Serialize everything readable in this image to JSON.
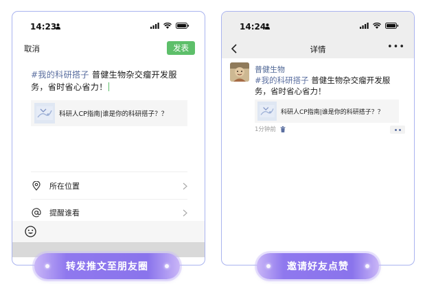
{
  "left_phone": {
    "status": {
      "time": "14:23"
    },
    "header": {
      "cancel_label": "取消",
      "publish_label": "发表"
    },
    "compose": {
      "hashtag": "#我的科研搭子",
      "text": " 普健生物杂交瘤开发服务，省时省心省力！"
    },
    "link_card": {
      "title": "科研人CP指南|谁是你的科研搭子？？"
    },
    "menu": [
      {
        "icon": "location-pin-icon",
        "label": "所在位置"
      },
      {
        "icon": "at-sign-icon",
        "label": "提醒谁看"
      }
    ],
    "toolbar": {
      "icon": "emoji-icon"
    }
  },
  "right_phone": {
    "status": {
      "time": "14:24"
    },
    "nav": {
      "title": "详情"
    },
    "post": {
      "username": "普健生物",
      "hashtag": "#我的科研搭子",
      "text": " 普健生物杂交瘤开发服务，省时省心省力！",
      "time": "1分钟前"
    },
    "link_card": {
      "title": "科研人CP指南|谁是你的科研搭子？？"
    }
  },
  "pills": {
    "left_label": "转发推文至朋友圈",
    "right_label": "邀请好友点赞"
  },
  "colors": {
    "accent_green": "#5dbf6a",
    "link_blue": "#5b6fa0",
    "frame_border": "#a9b3ef",
    "pill_purple": "#8f78ee"
  }
}
